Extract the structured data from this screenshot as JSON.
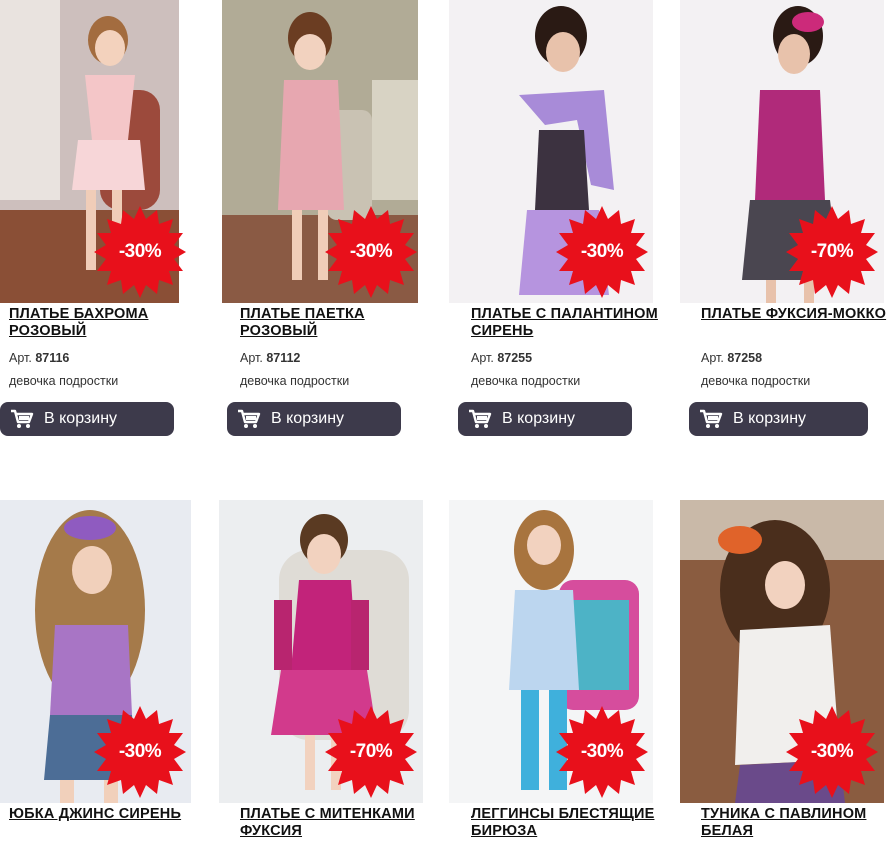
{
  "products": [
    {
      "name": "ПЛАТЬЕ БАХРОМА РОЗОВЫЙ",
      "art_prefix": "Арт.",
      "art": "87116",
      "category": "девочка подростки",
      "discount": "-30%",
      "cart_label": "В корзину",
      "bg": "#cfc3c3",
      "dress": "#f4c6c8",
      "hair": "#a36c3f"
    },
    {
      "name": "ПЛАТЬЕ ПАЕТКА РОЗОВЫЙ",
      "art_prefix": "Арт.",
      "art": "87112",
      "category": "девочка подростки",
      "discount": "-30%",
      "cart_label": "В корзину",
      "bg": "#b3ad98",
      "dress": "#e7a7b0",
      "hair": "#6b3d22"
    },
    {
      "name": "ПЛАТЬЕ С ПАЛАНТИНОМ СИРЕНЬ",
      "art_prefix": "Арт.",
      "art": "87255",
      "category": "девочка подростки",
      "discount": "-30%",
      "cart_label": "В корзину",
      "bg": "#f2f0f2",
      "dress": "#a88bd8",
      "hair": "#2a1a14"
    },
    {
      "name": "ПЛАТЬЕ ФУКСИЯ-МОККО",
      "art_prefix": "Арт.",
      "art": "87258",
      "category": "девочка подростки",
      "discount": "-70%",
      "cart_label": "В корзину",
      "bg": "#f2f0f2",
      "dress": "#b02a7a",
      "hair": "#2a1a14"
    },
    {
      "name": "ЮБКА ДЖИНС СИРЕНЬ",
      "discount": "-30%",
      "bg": "#e9ecf2",
      "dress": "#a875c5",
      "hair": "#a57a4a"
    },
    {
      "name": "ПЛАТЬЕ С МИТЕНКАМИ ФУКСИЯ",
      "discount": "-70%",
      "bg": "#eceef0",
      "dress": "#c2237a",
      "hair": "#5a3a22"
    },
    {
      "name": "ЛЕГГИНСЫ БЛЕСТЯЩИЕ БИРЮЗА",
      "discount": "-30%",
      "bg": "#f4f5f6",
      "dress": "#bcd6ef",
      "hair": "#a8743e"
    },
    {
      "name": "ТУНИКА С ПАВЛИНОМ БЕЛАЯ",
      "discount": "-30%",
      "bg": "#8a5c40",
      "dress": "#f1efed",
      "hair": "#4a2e1c"
    }
  ],
  "cart_icon": "shopping-cart-icon",
  "badge_color": "#e8101b",
  "button_color": "#3d3a4b"
}
